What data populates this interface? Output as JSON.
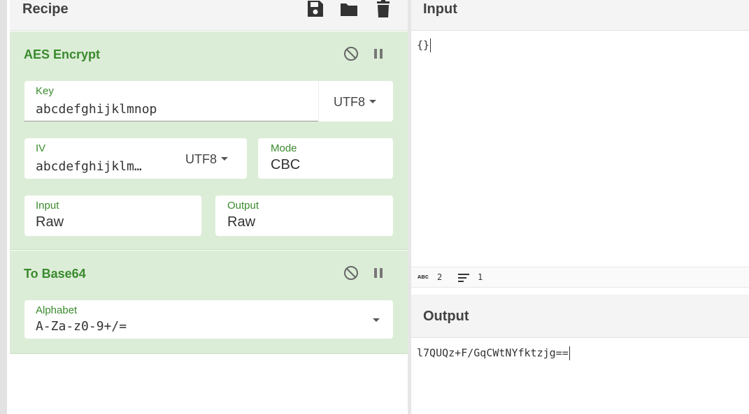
{
  "recipe": {
    "title": "Recipe",
    "header_icons": [
      "save-icon",
      "folder-icon",
      "trash-icon"
    ],
    "operations": [
      {
        "title": "AES Encrypt",
        "icons": [
          "disable-icon",
          "pause-icon"
        ],
        "key": {
          "label": "Key",
          "value": "abcdefghijklmnop",
          "encoding": "UTF8"
        },
        "iv": {
          "label": "IV",
          "value": "abcdefghijklm…",
          "encoding": "UTF8"
        },
        "mode": {
          "label": "Mode",
          "value": "CBC"
        },
        "input": {
          "label": "Input",
          "value": "Raw"
        },
        "output": {
          "label": "Output",
          "value": "Raw"
        }
      },
      {
        "title": "To Base64",
        "icons": [
          "disable-icon",
          "pause-icon"
        ],
        "alphabet": {
          "label": "Alphabet",
          "value": "A-Za-z0-9+/="
        }
      }
    ]
  },
  "input_pane": {
    "title": "Input",
    "text": "{}",
    "stats": {
      "length": "2",
      "lines": "1"
    }
  },
  "output_pane": {
    "title": "Output",
    "text": "l7QUQz+F/GqCWtNYfktzjg=="
  },
  "colors": {
    "op_bg": "#dcedd7",
    "op_text": "#3a8a2e",
    "header_bg": "#f4f4f4"
  }
}
